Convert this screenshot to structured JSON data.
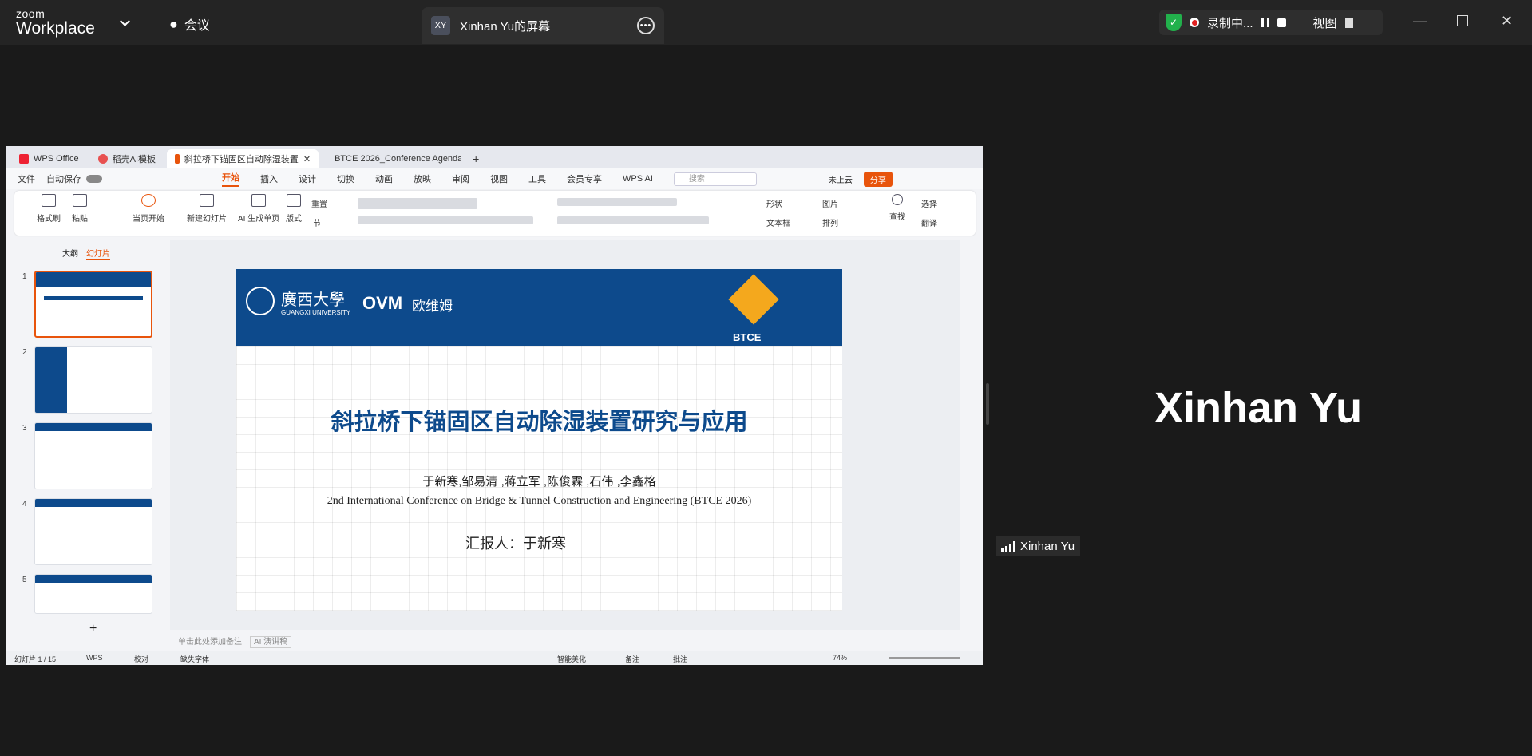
{
  "zoom": {
    "brand_top": "zoom",
    "brand_bottom": "Workplace",
    "meeting_label": "会议",
    "share_initials": "XY",
    "share_title": "Xinhan Yu的屏幕",
    "record_label": "录制中...",
    "view_label": "视图",
    "participant_name": "Xinhan Yu",
    "participant_tag": "Xinhan Yu"
  },
  "wps": {
    "tabs": [
      "WPS Office",
      "稻壳AI模板",
      "斜拉桥下锚固区自动除湿装置",
      "BTCE 2026_Conference Agenda.p"
    ],
    "menu": {
      "file": "文件",
      "autosave": "自动保存",
      "items": [
        "开始",
        "插入",
        "设计",
        "切换",
        "动画",
        "放映",
        "审阅",
        "视图",
        "工具",
        "会员专享",
        "WPS AI"
      ],
      "search_placeholder": "搜索",
      "cloud": "未上云",
      "share": "分享"
    },
    "ribbon": {
      "paint": "格式刷",
      "paste": "粘贴",
      "start_current": "当页开始",
      "new_slide": "新建幻灯片",
      "ai_single": "AI 生成单页",
      "layout": "版式",
      "reset": "重置",
      "section": "节",
      "shape": "形状",
      "image": "图片",
      "textbox": "文本框",
      "arrange": "排列",
      "find": "查找",
      "select": "选择",
      "translate": "翻译"
    },
    "panel": {
      "outline_tab": "大纲",
      "slides_tab": "幻灯片",
      "thumbs": [
        "1",
        "2",
        "3",
        "4",
        "5"
      ],
      "add": "+"
    },
    "slide": {
      "univ_cn": "廣西大學",
      "univ_en": "GUANGXI UNIVERSITY",
      "ovm": "OVM",
      "ovm_cn": "欧维姆",
      "btce": "BTCE",
      "title": "斜拉桥下锚固区自动除湿装置研究与应用",
      "authors": "于新寒,邹易清 ,蒋立军 ,陈俊霖 ,石伟 ,李鑫格",
      "conference": "2nd International Conference on Bridge & Tunnel Construction and Engineering (BTCE 2026)",
      "reporter": "汇报人：于新寒"
    },
    "notes": {
      "placeholder": "单击此处添加备注",
      "ai_notes": "AI 演讲稿"
    },
    "status": {
      "slide_count": "幻灯片 1 / 15",
      "wps": "WPS",
      "proof": "校对",
      "missing_font": "缺失字体",
      "beautify": "智能美化",
      "remark": "备注",
      "comment": "批注",
      "zoom": "74%"
    }
  },
  "colors": {
    "accent": "#e8540c",
    "banner": "#0d4a8c",
    "record": "#e02020",
    "shield": "#22b14c"
  }
}
